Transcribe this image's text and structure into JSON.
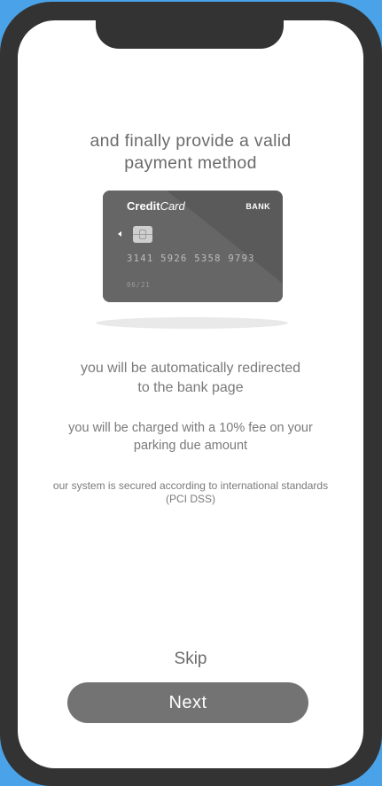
{
  "onboarding": {
    "title_line1": "and finally provide a valid",
    "title_line2": "payment method",
    "redirect_line1": "you will be automatically redirected",
    "redirect_line2": "to the bank page",
    "fee_line1": "you will be charged with a 10% fee on your",
    "fee_line2": "parking due amount",
    "security_line1": "our system is secured according to international standards",
    "security_line2": "(PCI DSS)"
  },
  "card": {
    "brand_bold": "Credit",
    "brand_italic": "Card",
    "bank": "BANK",
    "number": "3141 5926 5358 9793",
    "expiry": "06/21",
    "icons": [
      "chip-icon",
      "arrow-left-icon"
    ]
  },
  "actions": {
    "skip_label": "Skip",
    "next_label": "Next"
  },
  "colors": {
    "frame": "#333333",
    "background": "#4aa3e8",
    "card": "#5a5a5a",
    "button": "#737373",
    "text": "#7a7a7a"
  }
}
